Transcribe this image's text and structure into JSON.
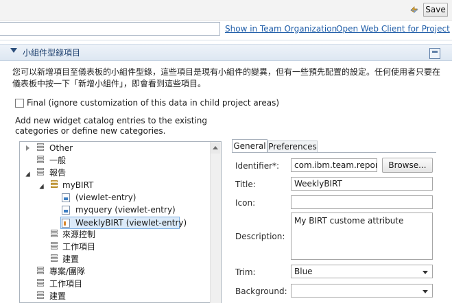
{
  "toolbar": {
    "save_label": "Save"
  },
  "links": {
    "show_in_team_org": "Show in Team Organization",
    "open_web_client": "Open Web Client for Project"
  },
  "section": {
    "title": "小組件型錄項目",
    "description_line1": "您可以新增項目至儀表板的小組件型錄，這些項目是現有小組件的變異，但有一些預先配置的設定。任何使用者只要在",
    "description_line2": "儀表板中按一下「新增小組件」，即會看到這些項目。"
  },
  "final_option": {
    "label": "Final (ignore customization of this data in child project areas)",
    "checked": false
  },
  "instruction": {
    "line1": "Add new widget catalog entries to the existing",
    "line2": "categories or define new categories."
  },
  "tree": {
    "items": [
      {
        "label": "Other",
        "expander": "closed",
        "icon": "category-icon"
      },
      {
        "label": "一般",
        "expander": "none",
        "icon": "category-icon"
      },
      {
        "label": "報告",
        "expander": "open",
        "icon": "category-icon"
      },
      {
        "label": "myBIRT",
        "expander": "open",
        "icon": "category-icon"
      },
      {
        "label": "(viewlet-entry)",
        "expander": "none",
        "icon": "viewlet-entry-icon"
      },
      {
        "label": "myquery (viewlet-entry)",
        "expander": "none",
        "icon": "viewlet-entry-icon"
      },
      {
        "label": "WeeklyBIRT (viewlet-entry)",
        "expander": "none",
        "icon": "viewlet-entry-icon",
        "selected": true
      },
      {
        "label": "來源控制",
        "expander": "none",
        "icon": "category-icon"
      },
      {
        "label": "工作項目",
        "expander": "none",
        "icon": "category-icon"
      },
      {
        "label": "建置",
        "expander": "none",
        "icon": "category-icon"
      },
      {
        "label": "專案/團隊",
        "expander": "none",
        "icon": "category-icon"
      },
      {
        "label": "工作項目",
        "expander": "none",
        "icon": "category-icon"
      },
      {
        "label": "建置",
        "expander": "none",
        "icon": "category-icon"
      }
    ]
  },
  "tabs": {
    "general": "General",
    "preferences": "Preferences",
    "active": "General"
  },
  "form": {
    "identifier_label": "Identifier*:",
    "identifier_value": "com.ibm.team.report",
    "browse_label": "Browse...",
    "title_label": "Title:",
    "title_value": "WeeklyBIRT",
    "icon_label": "Icon:",
    "icon_value": "",
    "description_label": "Description:",
    "description_value": "My BIRT custome attribute",
    "trim_label": "Trim:",
    "trim_value": "Blue",
    "background_label": "Background:",
    "background_value": ""
  }
}
